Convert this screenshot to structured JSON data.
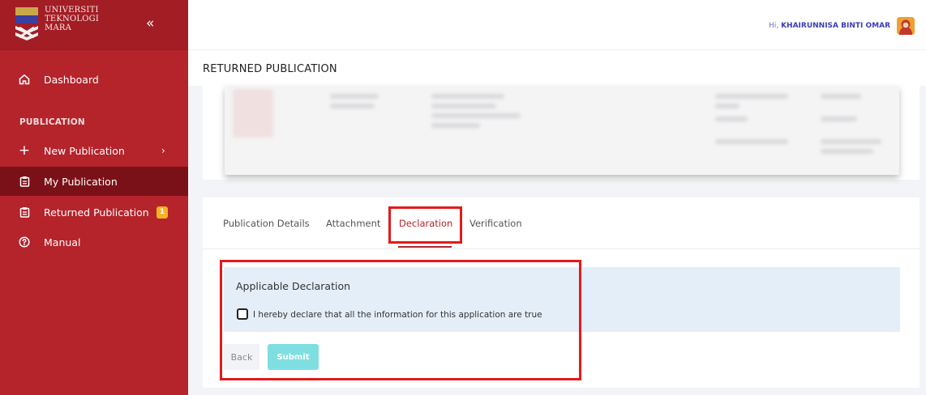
{
  "sidebar": {
    "logo_lines": [
      "UNIVERSITI",
      "TEKNOLOGI",
      "MARA"
    ],
    "collapse_icon": "«",
    "dashboard_label": "Dashboard",
    "section_label": "PUBLICATION",
    "items": [
      {
        "label": "New Publication",
        "icon": "plus-icon"
      },
      {
        "label": "My Publication",
        "icon": "clipboard-icon"
      },
      {
        "label": "Returned Publication",
        "icon": "clipboard-icon",
        "badge": "1"
      },
      {
        "label": "Manual",
        "icon": "help-icon"
      }
    ]
  },
  "topbar": {
    "hi": "Hi,",
    "user_name": "KHAIRUNNISA BINTI OMAR"
  },
  "page": {
    "title": "RETURNED PUBLICATION"
  },
  "tabs": [
    {
      "label": "Publication Details"
    },
    {
      "label": "Attachment"
    },
    {
      "label": "Declaration",
      "active": true
    },
    {
      "label": "Verification"
    }
  ],
  "declaration": {
    "title": "Applicable Declaration",
    "checkbox_label": "I hereby declare that all the information for this application are true",
    "checked": false
  },
  "buttons": {
    "back": "Back",
    "submit": "Submit"
  },
  "colors": {
    "sidebar": "#b5232b",
    "active_item": "#7b1118",
    "accent": "#b5232b",
    "highlight_box": "#e41a1a",
    "submit": "#7fdfe0",
    "declaration_bg": "#e4eef9"
  }
}
